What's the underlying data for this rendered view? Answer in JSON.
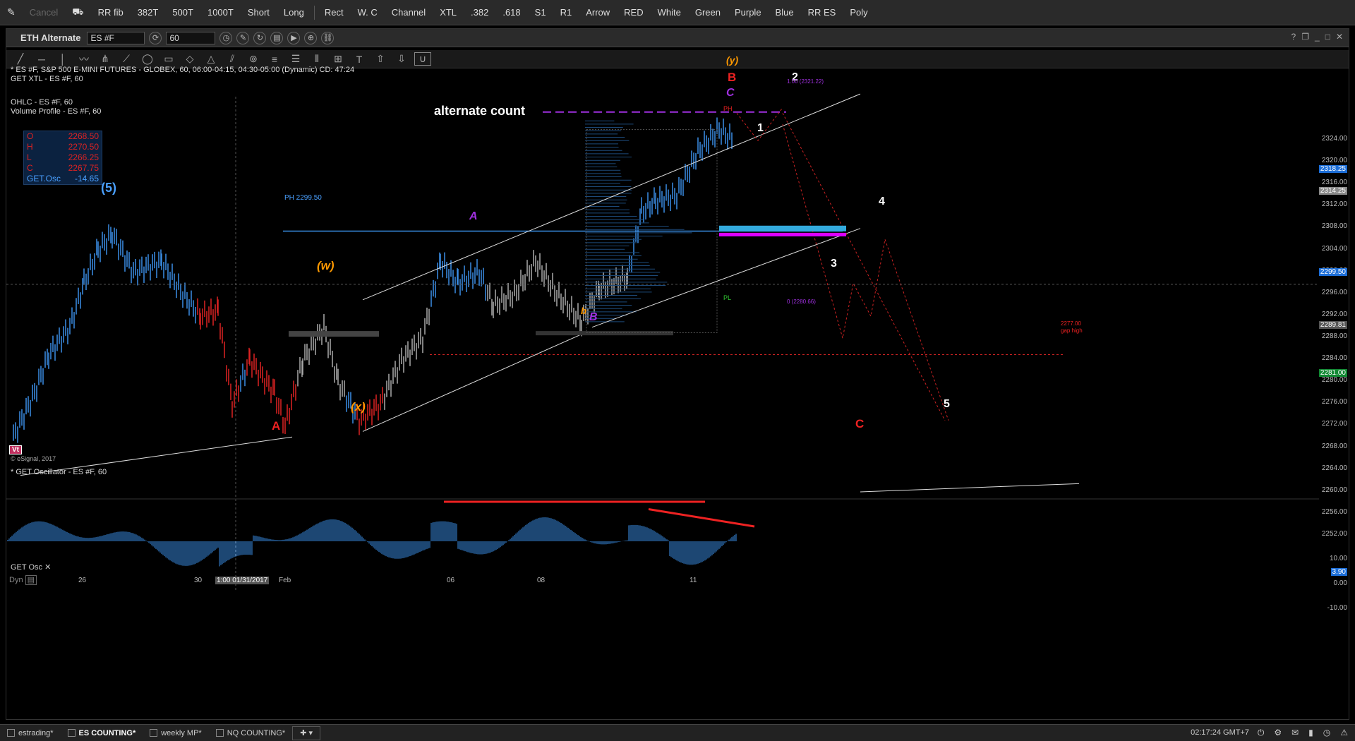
{
  "topbar": {
    "items": [
      "Cancel",
      "RR fib",
      "382T",
      "500T",
      "1000T",
      "Short",
      "Long",
      "Rect",
      "W. C",
      "Channel",
      "XTL",
      ".382",
      ".618",
      "S1",
      "R1",
      "Arrow",
      "RED",
      "White",
      "Green",
      "Purple",
      "Blue",
      "RR ES",
      "Poly"
    ]
  },
  "window": {
    "title": "ETH Alternate",
    "symbol": "ES #F",
    "interval": "60"
  },
  "header": {
    "line1": "* ES #F, S&P 500 E-MINI FUTURES - GLOBEX, 60, 06:00-04:15, 04:30-05:00 (Dynamic) CD: 47:24",
    "line2": "GET XTL - ES #F, 60",
    "line3": "OHLC - ES #F, 60",
    "line4": "Volume Profile - ES #F, 60"
  },
  "ohlc": {
    "o_label": "O",
    "o_value": "2268.50",
    "h_label": "H",
    "h_value": "2270.50",
    "l_label": "L",
    "l_value": "2266.25",
    "c_label": "C",
    "c_value": "2267.75",
    "osc_label": "GET.Osc",
    "osc_value": "-14.65"
  },
  "annotations": {
    "alternate_count": "alternate count",
    "wave5": "(5)",
    "wave_w": "(w)",
    "wave_x": "(x)",
    "wave_y": "(y)",
    "A_red": "A",
    "B_red": "B",
    "C_red": "C",
    "A_purple": "A",
    "B_purple": "B",
    "C_purple": "C",
    "b_small": "b",
    "n1": "1",
    "n2": "2",
    "n3": "3",
    "n4": "4",
    "n5": "5",
    "ph_line": "PH 2299.50",
    "fib_top": "1.00 (2321.22)",
    "fib_bottom": "0 (2280.66)",
    "gap_price": "2277.00",
    "gap_high": "gap high",
    "esignal": "© eSignal, 2017",
    "vt": "Vt",
    "pl": "PL",
    "ph_small": "PH"
  },
  "price_scale": [
    "2324.00",
    "2320.00",
    "2316.00",
    "2312.00",
    "2308.00",
    "2304.00",
    "2300.00",
    "2296.00",
    "2292.00",
    "2288.00",
    "2284.00",
    "2280.00",
    "2276.00",
    "2272.00",
    "2268.00",
    "2264.00",
    "2260.00",
    "2256.00",
    "2252.00"
  ],
  "price_tags": {
    "last": "2318.25",
    "close": "2314.25",
    "ph": "2299.50",
    "mid": "2289.81",
    "low": "2281.00"
  },
  "oscillator": {
    "title": "* GET Oscillator - ES #F, 60",
    "scale": [
      "10.00",
      "0.00",
      "-10.00"
    ],
    "value_tag": "3.90",
    "footer": "GET Osc"
  },
  "dates": [
    "26",
    "30",
    "1:00 01/31/2017",
    "Feb",
    "06",
    "08",
    "11"
  ],
  "dyn_label": "Dyn",
  "tabs": [
    "estrading*",
    "ES COUNTING*",
    "weekly MP*",
    "NQ COUNTING*"
  ],
  "active_tab": "ES COUNTING*",
  "clock": "02:17:24 GMT+7"
}
